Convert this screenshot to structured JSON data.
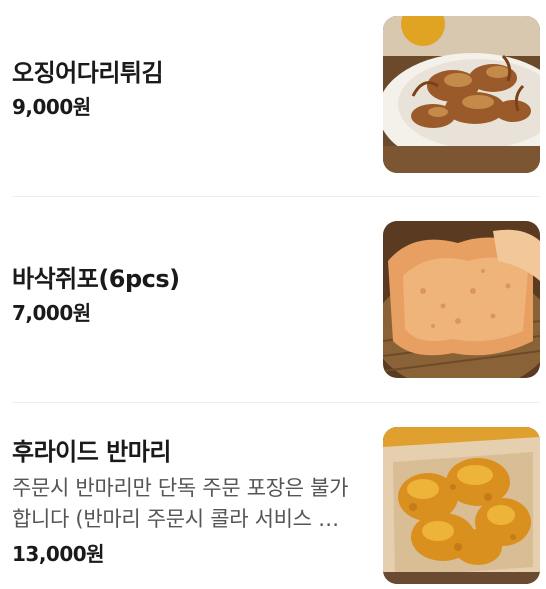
{
  "menu": {
    "items": [
      {
        "name": "오징어다리튀김",
        "price": "9,000원",
        "image": "fried-squid-legs-photo"
      },
      {
        "name": "바삭쥐포(6pcs)",
        "price": "7,000원",
        "image": "crispy-filefish-jerky-photo"
      },
      {
        "name": "후라이드 반마리",
        "description": "주문시 반마리만 단독 주문 포장은 불가합니다 (반마리 주문시 콜라 서비스 제외)",
        "price": "13,000원",
        "image": "fried-chicken-half-photo"
      }
    ]
  }
}
